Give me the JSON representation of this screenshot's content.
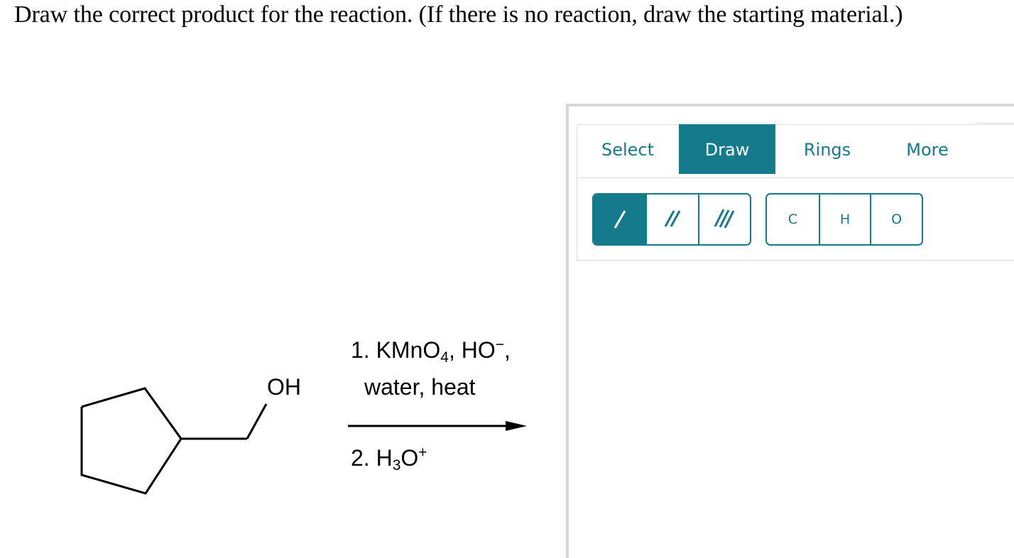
{
  "question": "Draw the correct product for the reaction. (If there is no reaction, draw the starting material.)",
  "reaction": {
    "substituent_label": "OH",
    "step1_prefix": "1. KMnO",
    "step1_sub": "4",
    "step1_sep": ",  HO",
    "step1_charge": "−",
    "step1_tail": ",",
    "step1_line2": "water, heat",
    "step2_prefix": "2. H",
    "step2_sub": "3",
    "step2_mid": "O",
    "step2_charge": "+"
  },
  "tabs": {
    "select": "Select",
    "draw": "Draw",
    "rings": "Rings",
    "more": "More",
    "active": "Draw"
  },
  "bond_tools": [
    "single-bond-icon",
    "double-bond-icon",
    "triple-bond-icon"
  ],
  "atom_tools": [
    "C",
    "H",
    "O"
  ],
  "colors": {
    "accent": "#157a8c",
    "border": "#dcdcdc"
  }
}
